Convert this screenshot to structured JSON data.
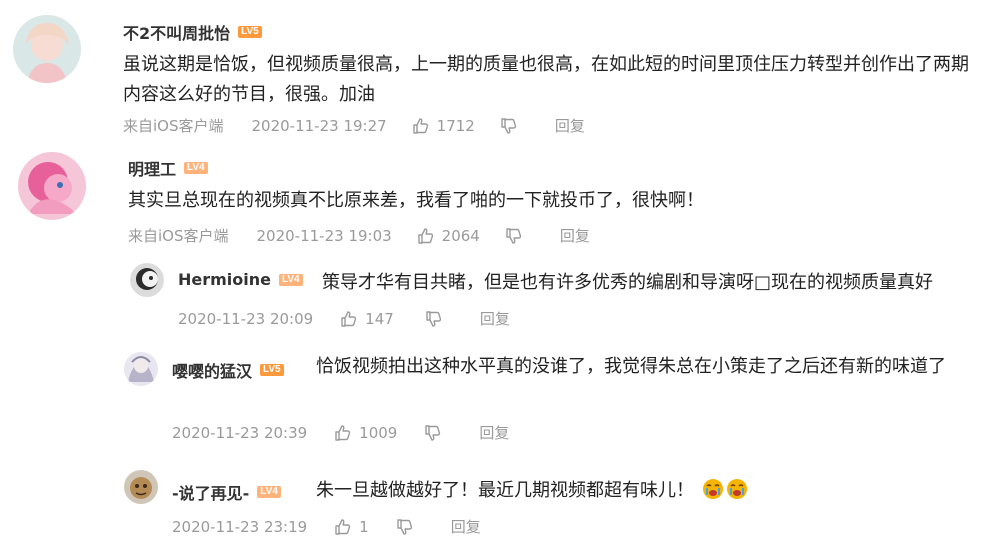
{
  "comments": [
    {
      "user": "不2不叫周批怡",
      "level": "LV5",
      "text": "虽说这期是恰饭，但视频质量很高，上一期的质量也很高，在如此短的时间里顶住压力转型并创作出了两期内容这么好的节目，很强。加油",
      "source": "来自iOS客户端",
      "time": "2020-11-23 19:27",
      "likes": "1712",
      "reply_label": "回复"
    },
    {
      "user": "明理工",
      "level": "LV4",
      "text": "其实旦总现在的视频真不比原来差，我看了啪的一下就投币了，很快啊！",
      "source": "来自iOS客户端",
      "time": "2020-11-23 19:03",
      "likes": "2064",
      "reply_label": "回复",
      "replies": [
        {
          "user": "Hermioine",
          "level": "LV4",
          "text": "策导才华有目共睹，但是也有许多优秀的编剧和导演呀□现在的视频质量真好",
          "time": "2020-11-23 20:09",
          "likes": "147",
          "reply_label": "回复"
        },
        {
          "user": "嘤嘤的猛汉",
          "level": "LV5",
          "text": "恰饭视频拍出这种水平真的没谁了，我觉得朱总在小策走了之后还有新的味道了",
          "time": "2020-11-23 20:39",
          "likes": "1009",
          "reply_label": "回复"
        },
        {
          "user": "-说了再见-",
          "level": "LV4",
          "text": "朱一旦越做越好了！最近几期视频都超有味儿！",
          "time": "2020-11-23 23:19",
          "likes": "1",
          "reply_label": "回复"
        }
      ]
    }
  ]
}
